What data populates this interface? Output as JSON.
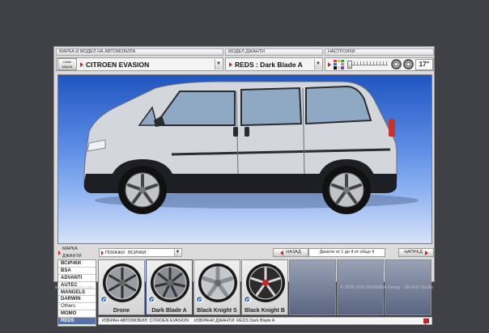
{
  "header": {
    "car_label": "МАРКА И МОДЕЛ НА АВТОМОБИЛА",
    "model_label": "МОДЕЛ ДЖАНТИ",
    "settings_label": "НАСТРОЙКИ"
  },
  "car_select": {
    "new_brand_line1": "нова",
    "new_brand_line2": "марка",
    "value": "CITROEN EVASION"
  },
  "model_select": {
    "value": "REDS : Dark Blade A"
  },
  "settings": {
    "rim_size": "17\"",
    "palette_colors": [
      "#e23c3c",
      "#f2b01e",
      "#3aa64a",
      "#2f6fd0",
      "#ffffff",
      "#999999",
      "#111111",
      "#d0d0d0",
      "#7a3fb0"
    ]
  },
  "viewer": {
    "car_body_color": "#d3d6db",
    "glass_color": "#8fa8c4",
    "wheel_color": "#c0c3c8"
  },
  "toolbar": {
    "wheel_brand_label": "МАРКА ДЖАНТИ",
    "show_label": "ПОКАЖИ",
    "show_value": "ВСИЧКИ",
    "back_label": "НАЗАД",
    "page_info": "Джанти от 1 до 4 от общо 4",
    "next_label": "НАПРЕД"
  },
  "brands": [
    {
      "label": "ВСИЧКИ",
      "selected": false
    },
    {
      "label": "BSA",
      "selected": false
    },
    {
      "label": "ADVANTI",
      "selected": false
    },
    {
      "label": "AUTEC",
      "selected": false
    },
    {
      "label": "MANGELS",
      "selected": false
    },
    {
      "label": "DARWIN",
      "selected": false
    },
    {
      "label": "Others",
      "selected": false
    },
    {
      "label": "MOMO",
      "selected": false
    },
    {
      "label": "REDS",
      "selected": true
    }
  ],
  "wheels": [
    {
      "name": "Drone",
      "active": false,
      "style": "drone"
    },
    {
      "name": "Dark Blade A",
      "active": true,
      "style": "blade"
    },
    {
      "name": "Black Knight S",
      "active": false,
      "style": "knight_s"
    },
    {
      "name": "Black Knight B",
      "active": false,
      "style": "knight_b"
    },
    {
      "name": "",
      "active": false,
      "style": "empty"
    },
    {
      "name": "",
      "active": false,
      "style": "empty"
    },
    {
      "name": "",
      "active": false,
      "style": "empty"
    }
  ],
  "status": {
    "car_label": "ИЗБРАН АВТОМОБИЛ:",
    "car_value": "CITROEN EVASION",
    "wheel_label": "ИЗБРАНИ ДЖАНТИ:",
    "wheel_value": "REDS Dark Blade A"
  },
  "footer": {
    "site": "www.avtogumi.com",
    "copyright": "© 2005-2011 BORAINA Group - SEVEN Studio"
  }
}
